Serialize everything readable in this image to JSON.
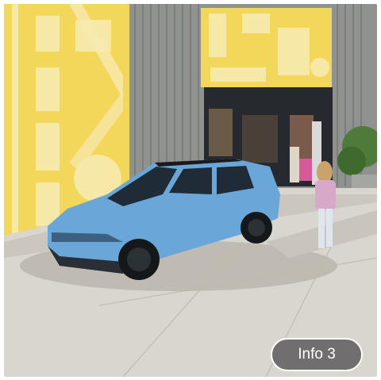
{
  "photo": {
    "icon": "photo-car-scene",
    "colors": {
      "wall_yellow": "#f2d75a",
      "wall_gray": "#8f928e",
      "car_blue": "#6aa6d8",
      "pavement": "#d9d6cf",
      "button_bg": "#626062"
    }
  },
  "info_button": {
    "label": "Info 3"
  }
}
